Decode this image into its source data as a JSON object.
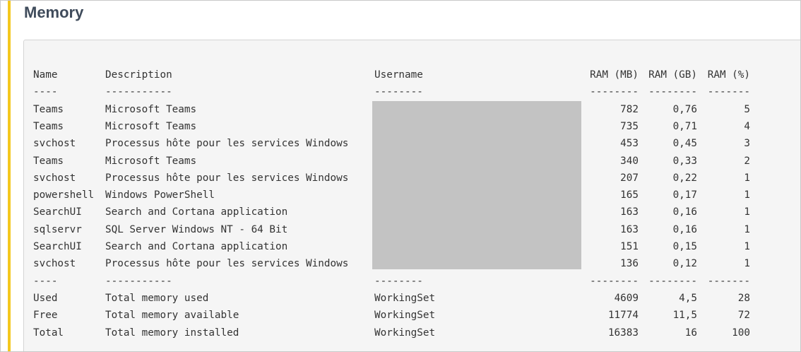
{
  "section": {
    "title": "Memory"
  },
  "colors": {
    "accent": "#f4c81f",
    "title": "#3f4b5b",
    "panel_bg": "#f5f5f5",
    "redaction": "#c3c3c3"
  },
  "table": {
    "headers": [
      "Name",
      "Description",
      "Username",
      "RAM (MB)",
      "RAM (GB)",
      "RAM (%)"
    ],
    "header_separators": [
      "----",
      "-----------",
      "--------",
      "--------",
      "--------",
      "-------"
    ],
    "rows": [
      [
        "Teams",
        "Microsoft Teams",
        "",
        "782",
        "0,76",
        "5"
      ],
      [
        "Teams",
        "Microsoft Teams",
        "",
        "735",
        "0,71",
        "4"
      ],
      [
        "svchost",
        "Processus hôte pour les services Windows",
        "",
        "453",
        "0,45",
        "3"
      ],
      [
        "Teams",
        "Microsoft Teams",
        "",
        "340",
        "0,33",
        "2"
      ],
      [
        "svchost",
        "Processus hôte pour les services Windows",
        "",
        "207",
        "0,22",
        "1"
      ],
      [
        "powershell",
        "Windows PowerShell",
        "",
        "165",
        "0,17",
        "1"
      ],
      [
        "SearchUI",
        "Search and Cortana application",
        "",
        "163",
        "0,16",
        "1"
      ],
      [
        "sqlservr",
        "SQL Server Windows NT - 64 Bit",
        "",
        "163",
        "0,16",
        "1"
      ],
      [
        "SearchUI",
        "Search and Cortana application",
        "",
        "151",
        "0,15",
        "1"
      ],
      [
        "svchost",
        "Processus hôte pour les services Windows",
        "",
        "136",
        "0,12",
        "1"
      ]
    ],
    "summary_separators": [
      "----",
      "-----------",
      "--------",
      "--------",
      "--------",
      "-------"
    ],
    "summary_rows": [
      [
        "Used",
        "Total memory used",
        "WorkingSet",
        "4609",
        "4,5",
        "28"
      ],
      [
        "Free",
        "Total memory available",
        "WorkingSet",
        "11774",
        "11,5",
        "72"
      ],
      [
        "Total",
        "Total memory installed",
        "WorkingSet",
        "16383",
        "16",
        "100"
      ]
    ]
  }
}
